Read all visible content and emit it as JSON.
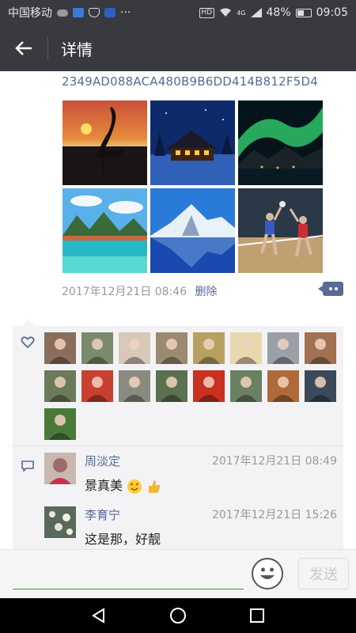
{
  "status_bar": {
    "carrier": "中国移动",
    "network": "4G",
    "hd": "HD",
    "battery": "48%",
    "time": "09:05",
    "more": "···"
  },
  "header": {
    "title": "详情"
  },
  "post": {
    "hash_text": "2349AD088ACA480B9B6DD414B812F5D4",
    "photos": [
      "crane-sunset",
      "snowy-cabin-night",
      "aurora-village",
      "tropical-lagoon-village",
      "snow-mountain-lake",
      "volleyball-players"
    ],
    "timestamp": "2017年12月21日 08:46",
    "delete_label": "删除"
  },
  "likes": {
    "avatars": [
      "#8a6d5a",
      "#7a8a6a",
      "#d8c8b8",
      "#9a8a70",
      "#b8a060",
      "#e8d8b0",
      "#9aa0a8",
      "#a07050",
      "#6a7a5a",
      "#c84030",
      "#8a8a80",
      "#5a7050",
      "#c83020",
      "#6a8060",
      "#b06a3a",
      "#3a4a5a",
      "#4a7a3a"
    ]
  },
  "comments": [
    {
      "name": "周淡定",
      "time": "2017年12月21日 08:49",
      "text": "景真美",
      "avatar_color": "#a06a6a"
    },
    {
      "name": "李育宁",
      "time": "2017年12月21日 15:26",
      "text": "这是那，好靓",
      "avatar_color": "#7a8a7a"
    }
  ],
  "input": {
    "placeholder": "",
    "send_label": "发送"
  },
  "colors": {
    "link": "#576b95",
    "bar": "#393a3f",
    "accent": "#1aad19"
  }
}
